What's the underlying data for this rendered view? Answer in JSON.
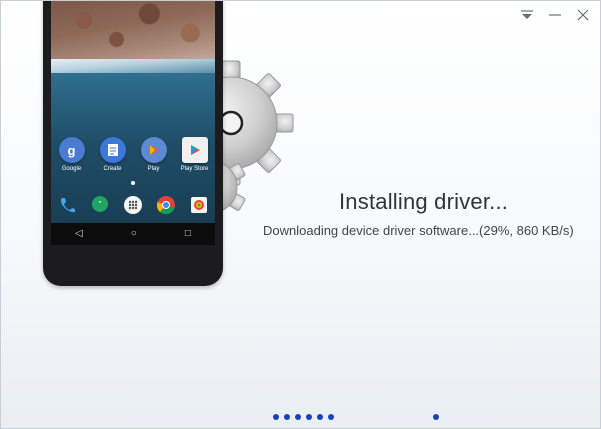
{
  "window": {
    "controls": [
      "dropdown",
      "minimize",
      "close"
    ]
  },
  "phone": {
    "apps": [
      {
        "label": "Google",
        "icon": "google-icon",
        "color": "#4a7bd1"
      },
      {
        "label": "Create",
        "icon": "docs-icon",
        "color": "#3b78d8"
      },
      {
        "label": "Play",
        "icon": "play-games-icon",
        "color": "#5d8ad2"
      },
      {
        "label": "Play Store",
        "icon": "play-store-icon",
        "color": "#f0f0f0"
      }
    ],
    "dock": [
      "phone-icon",
      "hangouts-icon",
      "app-drawer-icon",
      "chrome-icon",
      "photos-icon"
    ],
    "nav": {
      "back": "◁",
      "home": "○",
      "recents": "□"
    }
  },
  "status": {
    "title": "Installing driver...",
    "detail": "Downloading device driver software...(29%, 860 KB/s)",
    "progress_percent": 29,
    "speed": "860 KB/s"
  },
  "steps": {
    "group_count": 6,
    "single_count": 1,
    "color": "#1a3fbf"
  }
}
